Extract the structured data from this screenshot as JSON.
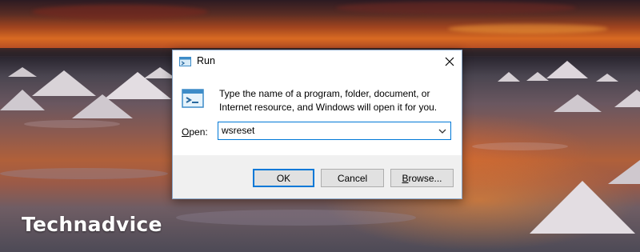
{
  "dialog": {
    "title": "Run",
    "message": "Type the name of a program, folder, document, or Internet resource, and Windows will open it for you.",
    "open_label_accel": "O",
    "open_label_rest": "pen:",
    "command_value": "wsreset",
    "ok_label": "OK",
    "cancel_label": "Cancel",
    "browse_label_accel": "B",
    "browse_label_rest": "rowse..."
  },
  "watermark": "Technadvice",
  "colors": {
    "accent": "#0078d7",
    "footer": "#f0f0f0",
    "button": "#e1e1e1"
  },
  "icons": [
    "run-icon",
    "close-icon",
    "chevron-down-icon"
  ]
}
